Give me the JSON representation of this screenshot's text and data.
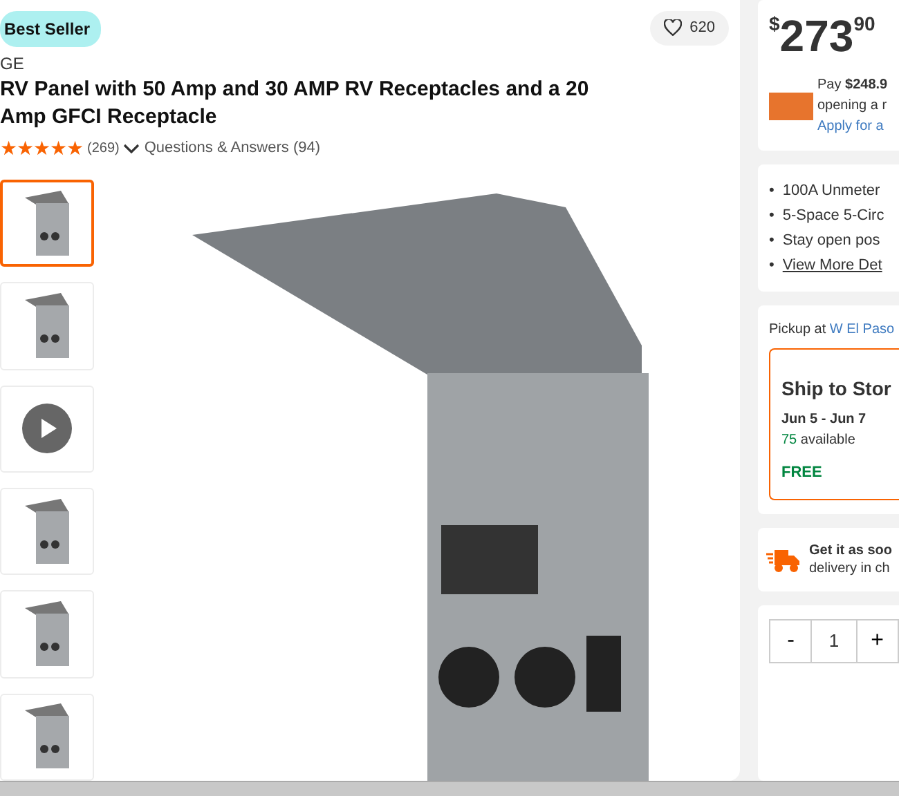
{
  "badge": "Best Seller",
  "favorite": {
    "count": "620"
  },
  "brand": "GE",
  "title": "RV Panel with 50 Amp and 30 AMP RV Receptacles and a 20 Amp GFCI Receptacle",
  "rating": {
    "stars": 5,
    "count": "(269)"
  },
  "questions_link": "Questions & Answers (94)",
  "thumbnails": [
    {
      "kind": "image",
      "selected": true
    },
    {
      "kind": "image",
      "selected": false
    },
    {
      "kind": "video",
      "selected": false
    },
    {
      "kind": "image",
      "selected": false
    },
    {
      "kind": "image",
      "selected": false
    },
    {
      "kind": "image",
      "selected": false
    }
  ],
  "price": {
    "currency": "$",
    "dollars": "273",
    "cents": "90",
    "promo": [
      "Pay **$248.9**",
      "opening a r"
    ],
    "apply_link": "Apply for a"
  },
  "features": [
    {
      "bullet": "•",
      "text": "100A Unmeter",
      "kind": "text"
    },
    {
      "bullet": "•",
      "text": "5-Space 5-Circ",
      "kind": "text"
    },
    {
      "bullet": "•",
      "text": "Stay open pos",
      "kind": "text"
    },
    {
      "bullet": "•",
      "text": "View More Det",
      "kind": "link"
    }
  ],
  "pickup": {
    "label": "Pickup at",
    "store": "W El Paso"
  },
  "ship_option": {
    "title": "Ship to Stor",
    "dates": "Jun 5 - Jun 7",
    "stock": "75",
    "stock_label": "available",
    "price": "FREE",
    "selected": true
  },
  "delivery": {
    "title": "Get it as soo",
    "subtitle": "delivery in ch"
  },
  "quantity": {
    "minus": "-",
    "value": "1",
    "plus": "+"
  }
}
